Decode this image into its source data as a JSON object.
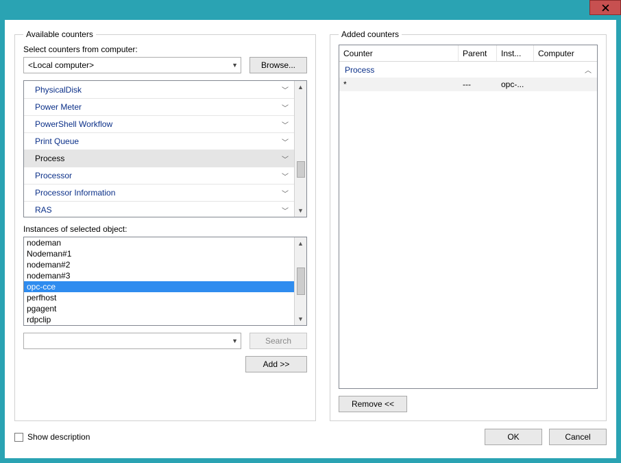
{
  "window": {
    "close_tooltip": "Close"
  },
  "left": {
    "group_title": "Available counters",
    "select_label": "Select counters from computer:",
    "computer_value": "<Local computer>",
    "browse_label": "Browse...",
    "counters": [
      {
        "name": "PhysicalDisk",
        "selected": false
      },
      {
        "name": "Power Meter",
        "selected": false
      },
      {
        "name": "PowerShell Workflow",
        "selected": false
      },
      {
        "name": "Print Queue",
        "selected": false
      },
      {
        "name": "Process",
        "selected": true
      },
      {
        "name": "Processor",
        "selected": false
      },
      {
        "name": "Processor Information",
        "selected": false
      },
      {
        "name": "RAS",
        "selected": false
      }
    ],
    "instances_label": "Instances of selected object:",
    "instances": [
      {
        "name": "nodeman",
        "selected": false
      },
      {
        "name": "Nodeman#1",
        "selected": false
      },
      {
        "name": "nodeman#2",
        "selected": false
      },
      {
        "name": "nodeman#3",
        "selected": false
      },
      {
        "name": "opc-cce",
        "selected": true
      },
      {
        "name": "perfhost",
        "selected": false
      },
      {
        "name": "pgagent",
        "selected": false
      },
      {
        "name": "rdpclip",
        "selected": false
      }
    ],
    "search_value": "",
    "search_label": "Search",
    "add_label": "Add >>"
  },
  "right": {
    "group_title": "Added counters",
    "columns": {
      "counter": "Counter",
      "parent": "Parent",
      "inst": "Inst...",
      "computer": "Computer"
    },
    "group_name": "Process",
    "row": {
      "counter": "*",
      "parent": "---",
      "inst": "opc-...",
      "computer": ""
    },
    "remove_label": "Remove <<"
  },
  "footer": {
    "show_desc": "Show description",
    "ok": "OK",
    "cancel": "Cancel"
  }
}
